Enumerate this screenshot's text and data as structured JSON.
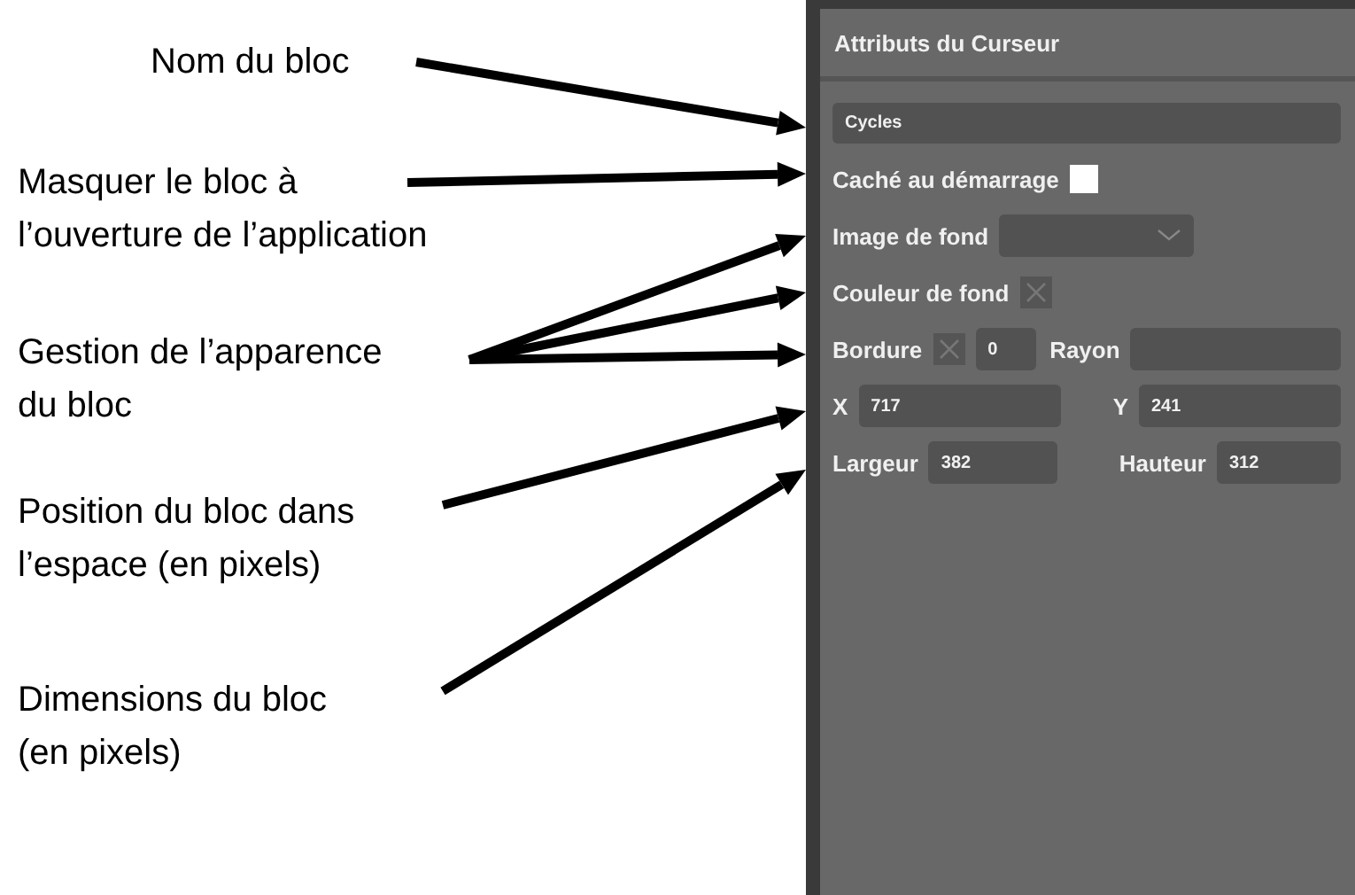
{
  "annotations": [
    {
      "lines": [
        "Nom du bloc"
      ]
    },
    {
      "lines": [
        "Masquer le bloc à",
        "l’ouverture de l’application"
      ]
    },
    {
      "lines": [
        "Gestion de l’apparence",
        "du bloc"
      ]
    },
    {
      "lines": [
        "Position du bloc dans",
        "l’espace (en pixels)"
      ]
    },
    {
      "lines": [
        "Dimensions du bloc",
        "(en pixels)"
      ]
    }
  ],
  "panel": {
    "title": "Attributs du Curseur",
    "name_field": {
      "value": "Cycles"
    },
    "hidden_at_start": {
      "label": "Caché au démarrage",
      "checked": false
    },
    "background_image": {
      "label": "Image de fond"
    },
    "background_color": {
      "label": "Couleur de fond"
    },
    "border": {
      "label": "Bordure",
      "value": "0"
    },
    "radius": {
      "label": "Rayon"
    },
    "x": {
      "label": "X",
      "value": "717"
    },
    "y": {
      "label": "Y",
      "value": "241"
    },
    "width": {
      "label": "Largeur",
      "value": "382"
    },
    "height": {
      "label": "Hauteur",
      "value": "312"
    }
  }
}
